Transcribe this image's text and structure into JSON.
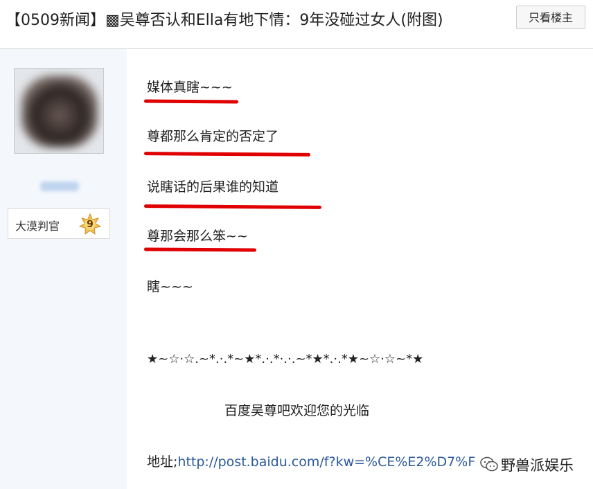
{
  "header": {
    "thread_title": "【0509新闻】▩吴尊否认和Ella有地下情：9年没碰过女人(附图)",
    "only_op_button": "只看楼主"
  },
  "author": {
    "rank_label": "大漠判官",
    "level": "9"
  },
  "post": {
    "lines": [
      "媒体真瞎~~~",
      "尊都那么肯定的否定了",
      "说瞎话的后果谁的知道",
      "尊那会那么笨~~",
      "瞎~~~"
    ],
    "stars_line": "★~☆·☆.~*.·.*~★*.·.*·.·.~*★*.·.*★~☆·☆~*★",
    "welcome": "百度吴尊吧欢迎您的光临",
    "address_label": "地址;",
    "address_link": "http://post.baidu.com/f?kw=%CE%E2%D7%F"
  },
  "watermark": {
    "text": "野兽派娱乐",
    "icon": "wechat-icon"
  },
  "colors": {
    "underline": "#e00000",
    "link": "#2b5a9c",
    "sidebar_bg": "#f4f8fc"
  }
}
